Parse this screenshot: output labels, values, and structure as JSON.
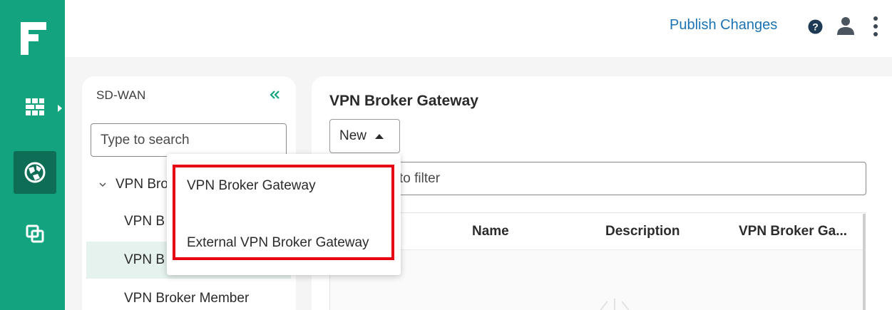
{
  "header": {
    "publish_label": "Publish Changes"
  },
  "rail": {
    "items": [
      "brand-logo",
      "firewall-icon",
      "network-globe-icon",
      "copy-icon"
    ],
    "accent": "#14a37f",
    "active_bg": "#0e6d55"
  },
  "nav": {
    "heading": "SD-WAN",
    "search_placeholder": "Type to search",
    "group_label": "VPN Bro",
    "items": [
      {
        "label": "VPN B"
      },
      {
        "label": "VPN B"
      },
      {
        "label": "VPN Broker Member"
      }
    ]
  },
  "main": {
    "title": "VPN Broker Gateway",
    "new_label": "New",
    "filter_tail": "to filter",
    "columns": [
      "Name",
      "Description",
      "VPN Broker Ga..."
    ]
  },
  "dropdown": {
    "options": [
      "VPN Broker Gateway",
      "External VPN Broker Gateway"
    ],
    "highlight_color": "#e60012"
  }
}
